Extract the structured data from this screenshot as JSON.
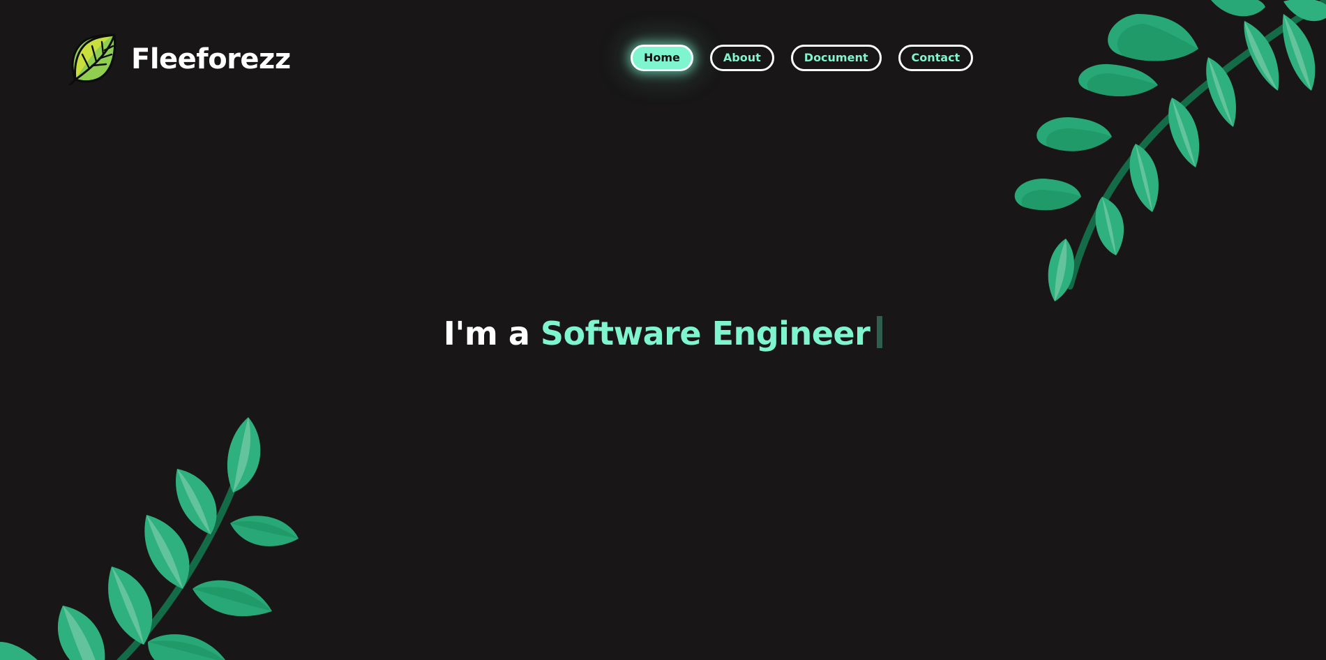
{
  "brand": {
    "name": "Fleeforezz",
    "logo_icon": "leaf-icon"
  },
  "nav": {
    "items": [
      {
        "label": "Home",
        "active": true
      },
      {
        "label": "About",
        "active": false
      },
      {
        "label": "Document",
        "active": false
      },
      {
        "label": "Contact",
        "active": false
      }
    ]
  },
  "hero": {
    "prefix": "I'm a",
    "role": "Software Engineer"
  },
  "decorations": {
    "top_right": "vine-leaves-illustration",
    "bottom_left": "vine-leaves-illustration"
  },
  "colors": {
    "background": "#181617",
    "accent": "#7ef5cf",
    "leaf_main": "#2fb07f",
    "leaf_dark": "#1f9a68",
    "leaf_light": "#63c49b",
    "stem": "#136b47"
  }
}
